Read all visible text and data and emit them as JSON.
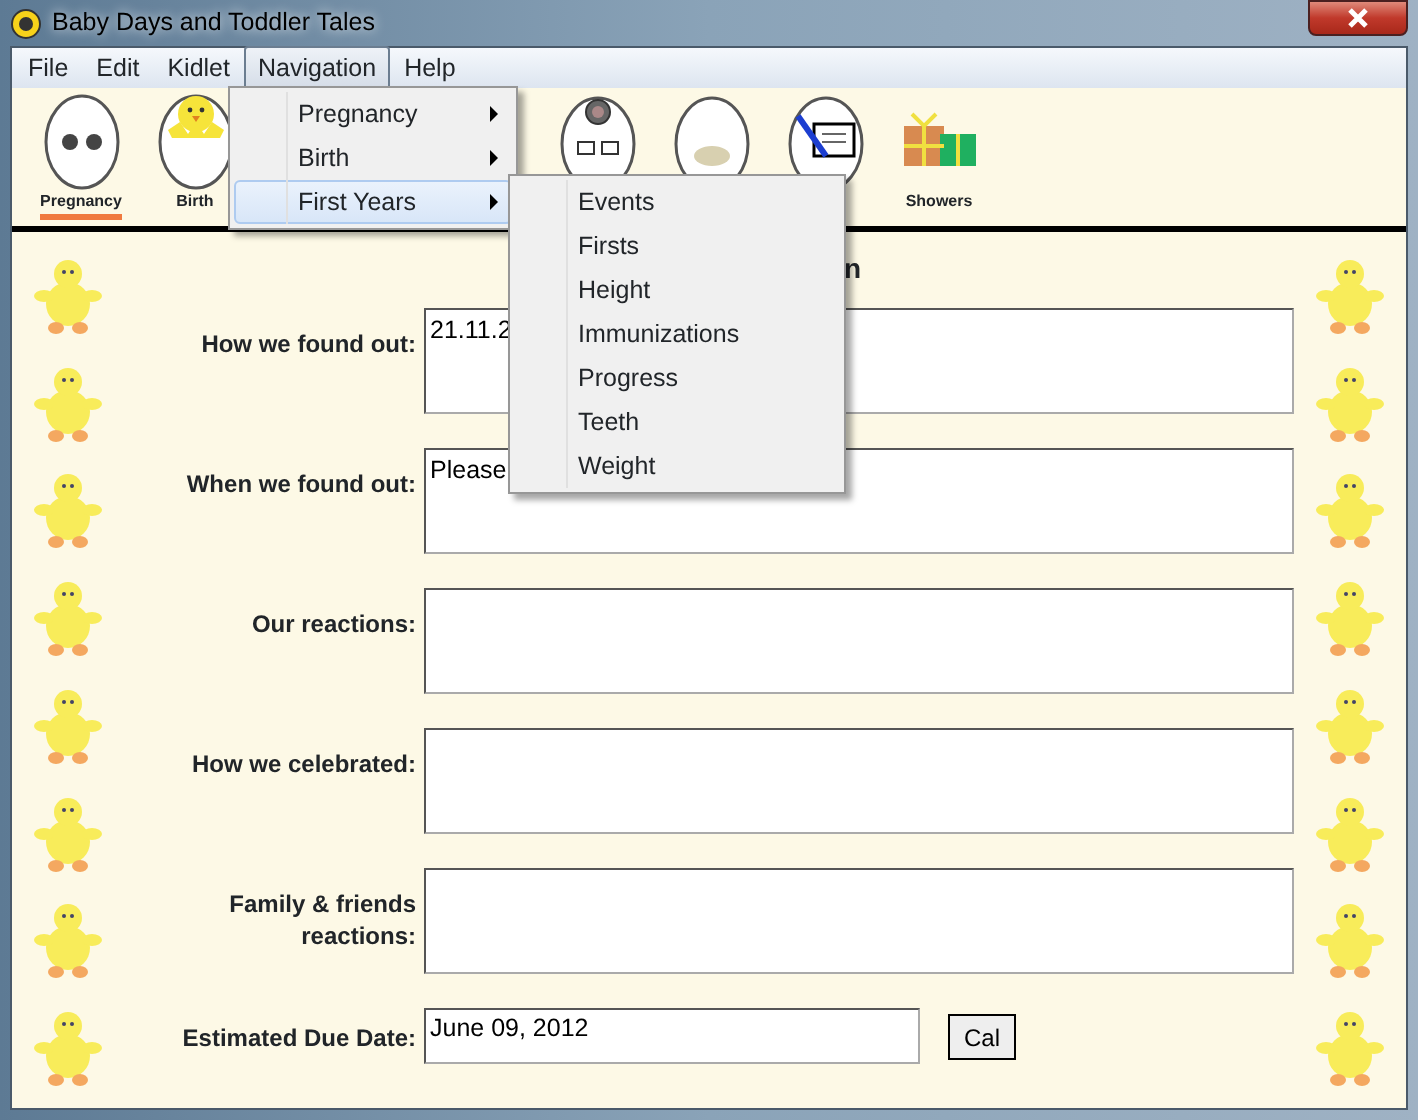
{
  "window": {
    "title": "Baby Days and Toddler Tales"
  },
  "menubar": [
    {
      "label": "File",
      "selected": false
    },
    {
      "label": "Edit",
      "selected": false
    },
    {
      "label": "Kidlet",
      "selected": false
    },
    {
      "label": "Navigation",
      "selected": true
    },
    {
      "label": "Help",
      "selected": false
    }
  ],
  "toolbar": [
    {
      "kind": "egg-eyes",
      "label": "Pregnancy",
      "selected": true
    },
    {
      "kind": "egg-chick",
      "label": "Birth",
      "selected": false
    },
    {
      "kind": "spacer"
    },
    {
      "kind": "egg-doctor"
    },
    {
      "kind": "egg-plain"
    },
    {
      "kind": "paper"
    },
    {
      "kind": "gift",
      "label": "Showers",
      "selected": false
    }
  ],
  "navigation_menu": [
    {
      "label": "Pregnancy",
      "has_submenu": true,
      "selected": false
    },
    {
      "label": "Birth",
      "has_submenu": true,
      "selected": false
    },
    {
      "label": "First Years",
      "has_submenu": true,
      "selected": true
    }
  ],
  "submenu": [
    {
      "label": "Events"
    },
    {
      "label": "Firsts"
    },
    {
      "label": "Height"
    },
    {
      "label": "Immunizations"
    },
    {
      "label": "Progress"
    },
    {
      "label": "Teeth"
    },
    {
      "label": "Weight"
    }
  ],
  "form": {
    "heading": "n",
    "fields": [
      {
        "label": "How we found out:",
        "value": "21.11.2",
        "kind": "area"
      },
      {
        "label": "When we found out:",
        "value": "Please",
        "kind": "area"
      },
      {
        "label": "Our reactions:",
        "kind": "area"
      },
      {
        "label": "How we celebrated:",
        "kind": "area"
      },
      {
        "label": "Family & friends reactions:",
        "kind": "area"
      },
      {
        "label": "Estimated Due Date:",
        "value": "June 09, 2012",
        "kind": "date",
        "button": "Cal"
      }
    ]
  }
}
